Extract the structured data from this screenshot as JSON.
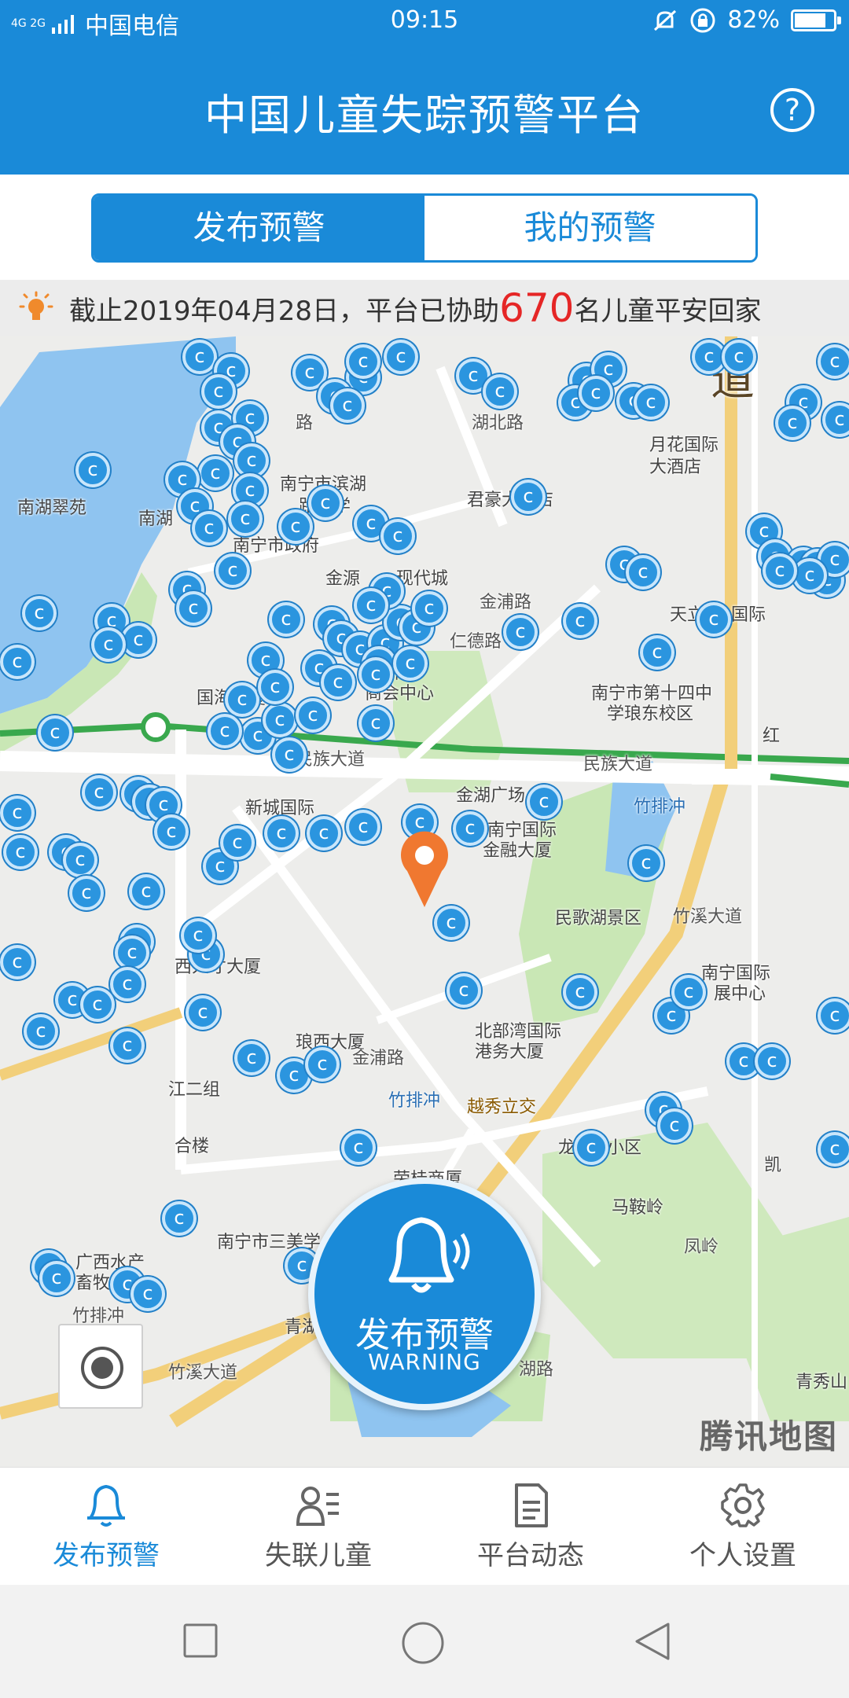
{
  "status_bar": {
    "network": "4G 2G",
    "carrier": "中国电信",
    "time": "09:15",
    "battery": "82%",
    "battery_level": 0.82
  },
  "header": {
    "title": "中国儿童失踪预警平台",
    "help_icon": "question-circle-icon",
    "help_label": "?"
  },
  "tabs": [
    {
      "label": "发布预警",
      "active": true
    },
    {
      "label": "我的预警",
      "active": false
    }
  ],
  "notice": {
    "icon": "lightbulb-icon",
    "prefix": "截止2019年04月28日，平台已协助",
    "count": "670",
    "suffix": "名儿童平安回家"
  },
  "map": {
    "labels": [
      "南湖翠苑",
      "南湖",
      "南宁市滨湖",
      "路小学",
      "君豪大酒店",
      "月花国际",
      "大酒店",
      "南宁市政府",
      "金源",
      "现代城",
      "金浦路",
      "仁德路",
      "天立·",
      "国际",
      "国海大厦",
      "国际",
      "商会中心",
      "南宁市第十四中",
      "学琅东校区",
      "红",
      "民族大道",
      "民族大道",
      "新城国际",
      "金湖广场",
      "南宁国际",
      "金融大厦",
      "竹排冲",
      "民歌湖景区",
      "竹溪大道",
      "南宁国际",
      "展中心",
      "西人才大厦",
      "琅西大厦",
      "北部湾国际",
      "港务大厦",
      "金浦路",
      "竹排冲",
      "越秀立交",
      "江二组",
      "合楼",
      "荣桂商厦",
      "龙",
      "小区",
      "马鞍岭",
      "凯",
      "南宁市三美学",
      "广西水产",
      "畜牧",
      "竹排冲",
      "青湖",
      "竹溪大道",
      "湖路",
      "青秀山",
      "凤岭",
      "道",
      "路",
      "湖北路"
    ],
    "provider": "腾讯地图",
    "marker_icon": "location-pin-icon",
    "child_marker_icon": "child-alert-marker-icon"
  },
  "publish_button": {
    "icon": "bell-icon",
    "label": "发布预警",
    "sublabel": "WARNING"
  },
  "locate_button": {
    "icon": "locate-icon"
  },
  "bottom_nav": [
    {
      "label": "发布预警",
      "icon": "bell-icon",
      "active": true
    },
    {
      "label": "失联儿童",
      "icon": "person-list-icon",
      "active": false
    },
    {
      "label": "平台动态",
      "icon": "document-icon",
      "active": false
    },
    {
      "label": "个人设置",
      "icon": "gear-icon",
      "active": false
    }
  ],
  "system_nav": [
    {
      "icon": "square-recent-icon"
    },
    {
      "icon": "circle-home-icon"
    },
    {
      "icon": "triangle-back-icon"
    }
  ],
  "colors": {
    "primary": "#1a8ad8",
    "highlight": "#e52626",
    "marker": "#2b95df",
    "location_pin": "#f07830"
  }
}
